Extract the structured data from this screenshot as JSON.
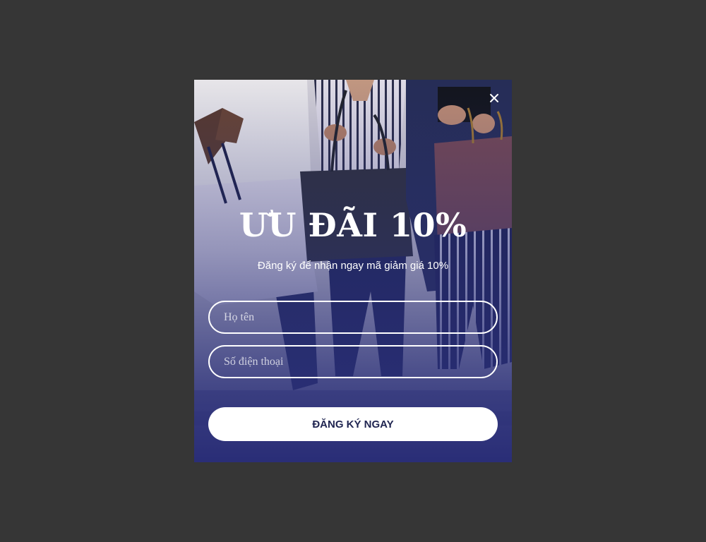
{
  "popup": {
    "close_icon": "close-icon",
    "headline": "ƯU ĐÃI 10%",
    "subtitle": "Đăng ký để nhận ngay mã giảm giá 10%",
    "form": {
      "name_placeholder": "Họ tên",
      "phone_placeholder": "Số điện thoại",
      "submit_label": "ĐĂNG KÝ NGAY"
    },
    "colors": {
      "backdrop": "#363636",
      "overlay_tint": "#2a2f78",
      "button_bg": "#ffffff",
      "button_text": "#1f2450"
    }
  }
}
